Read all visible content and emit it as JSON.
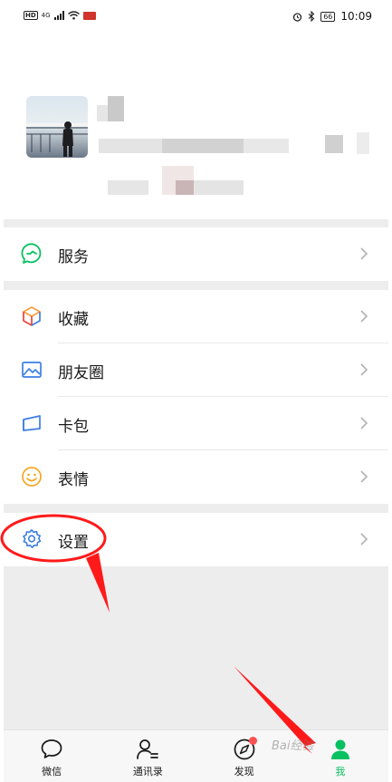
{
  "status_bar": {
    "left_badges": [
      "HD",
      "4G"
    ],
    "time": "10:09",
    "battery": "66"
  },
  "profile": {
    "name_redacted": true
  },
  "menu": {
    "services": {
      "label": "服务",
      "icon": "services-icon"
    },
    "items": [
      {
        "label": "收藏",
        "icon": "favorites-cube-icon"
      },
      {
        "label": "朋友圈",
        "icon": "moments-picture-icon"
      },
      {
        "label": "卡包",
        "icon": "card-wallet-icon"
      },
      {
        "label": "表情",
        "icon": "sticker-smiley-icon"
      }
    ],
    "settings": {
      "label": "设置",
      "icon": "gear-icon"
    }
  },
  "tabs": [
    {
      "label": "微信",
      "icon": "chat-bubble-icon"
    },
    {
      "label": "通讯录",
      "icon": "contacts-icon"
    },
    {
      "label": "发现",
      "icon": "compass-icon",
      "badge": "dot"
    },
    {
      "label": "我",
      "icon": "me-icon",
      "active": true
    }
  ],
  "colors": {
    "accent": "#07c160",
    "annotation": "#ff1a1a",
    "badge": "#fa5151"
  },
  "watermark": "Bai经验"
}
